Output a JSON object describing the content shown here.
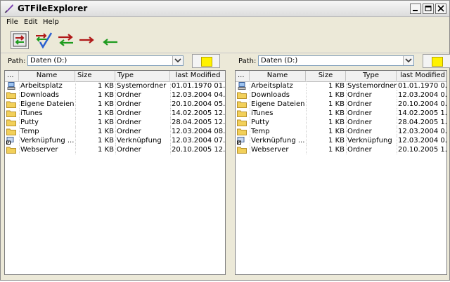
{
  "window": {
    "title": "GTFileExplorer",
    "icon": "feather-pen-icon"
  },
  "menu": [
    "File",
    "Edit",
    "Help"
  ],
  "toolbar": {
    "buttons": [
      {
        "name": "compare-panes",
        "icon": "compare-panes-icon",
        "pressed": true
      },
      {
        "name": "sync-check",
        "icon": "sync-check-icon"
      },
      {
        "name": "sync-both",
        "icon": "arrows-both-icon"
      },
      {
        "name": "copy-right",
        "icon": "arrow-right-icon"
      },
      {
        "name": "copy-left",
        "icon": "arrow-left-icon"
      }
    ]
  },
  "colors": {
    "folder": "#f2d05a",
    "arrow_red": "#b01818",
    "arrow_green": "#1e9b1e",
    "check_blue": "#2a5fd0"
  },
  "left_pane": {
    "path_label": "Path:",
    "path_value": "Daten (D:)",
    "columns": [
      "...",
      "Name",
      "Size",
      "Type",
      "last Modified"
    ],
    "rows": [
      {
        "icon": "computer-icon",
        "name": "Arbeitsplatz",
        "size": "1 KB",
        "type": "Systemordner",
        "modified": "01.01.1970 01..."
      },
      {
        "icon": "folder-icon",
        "name": "Downloads",
        "size": "1 KB",
        "type": "Ordner",
        "modified": "12.03.2004 04..."
      },
      {
        "icon": "folder-icon",
        "name": "Eigene Dateien",
        "size": "1 KB",
        "type": "Ordner",
        "modified": "20.10.2004 05..."
      },
      {
        "icon": "folder-icon",
        "name": "iTunes",
        "size": "1 KB",
        "type": "Ordner",
        "modified": "14.02.2005 12..."
      },
      {
        "icon": "folder-icon",
        "name": "Putty",
        "size": "1 KB",
        "type": "Ordner",
        "modified": "28.04.2005 12..."
      },
      {
        "icon": "folder-icon",
        "name": "Temp",
        "size": "1 KB",
        "type": "Ordner",
        "modified": "12.03.2004 08..."
      },
      {
        "icon": "shortcut-icon",
        "name": "Verknüpfung ...",
        "size": "1 KB",
        "type": "Verknüpfung",
        "modified": "12.03.2004 07..."
      },
      {
        "icon": "folder-icon",
        "name": "Webserver",
        "size": "1 KB",
        "type": "Ordner",
        "modified": "20.10.2005 12..."
      }
    ]
  },
  "right_pane": {
    "path_label": "Path:",
    "path_value": "Daten (D:)",
    "columns": [
      "...",
      "Name",
      "Size",
      "Type",
      "last Modified"
    ],
    "rows": [
      {
        "icon": "computer-icon",
        "name": "Arbeitsplatz",
        "size": "1 KB",
        "type": "Systemordner",
        "modified": "01.01.1970 0..."
      },
      {
        "icon": "folder-icon",
        "name": "Downloads",
        "size": "1 KB",
        "type": "Ordner",
        "modified": "12.03.2004 0..."
      },
      {
        "icon": "folder-icon",
        "name": "Eigene Dateien",
        "size": "1 KB",
        "type": "Ordner",
        "modified": "20.10.2004 0..."
      },
      {
        "icon": "folder-icon",
        "name": "iTunes",
        "size": "1 KB",
        "type": "Ordner",
        "modified": "14.02.2005 1..."
      },
      {
        "icon": "folder-icon",
        "name": "Putty",
        "size": "1 KB",
        "type": "Ordner",
        "modified": "28.04.2005 1..."
      },
      {
        "icon": "folder-icon",
        "name": "Temp",
        "size": "1 KB",
        "type": "Ordner",
        "modified": "12.03.2004 0..."
      },
      {
        "icon": "shortcut-icon",
        "name": "Verknüpfung ...",
        "size": "1 KB",
        "type": "Verknüpfung",
        "modified": "12.03.2004 0..."
      },
      {
        "icon": "folder-icon",
        "name": "Webserver",
        "size": "1 KB",
        "type": "Ordner",
        "modified": "20.10.2005 1..."
      }
    ]
  }
}
